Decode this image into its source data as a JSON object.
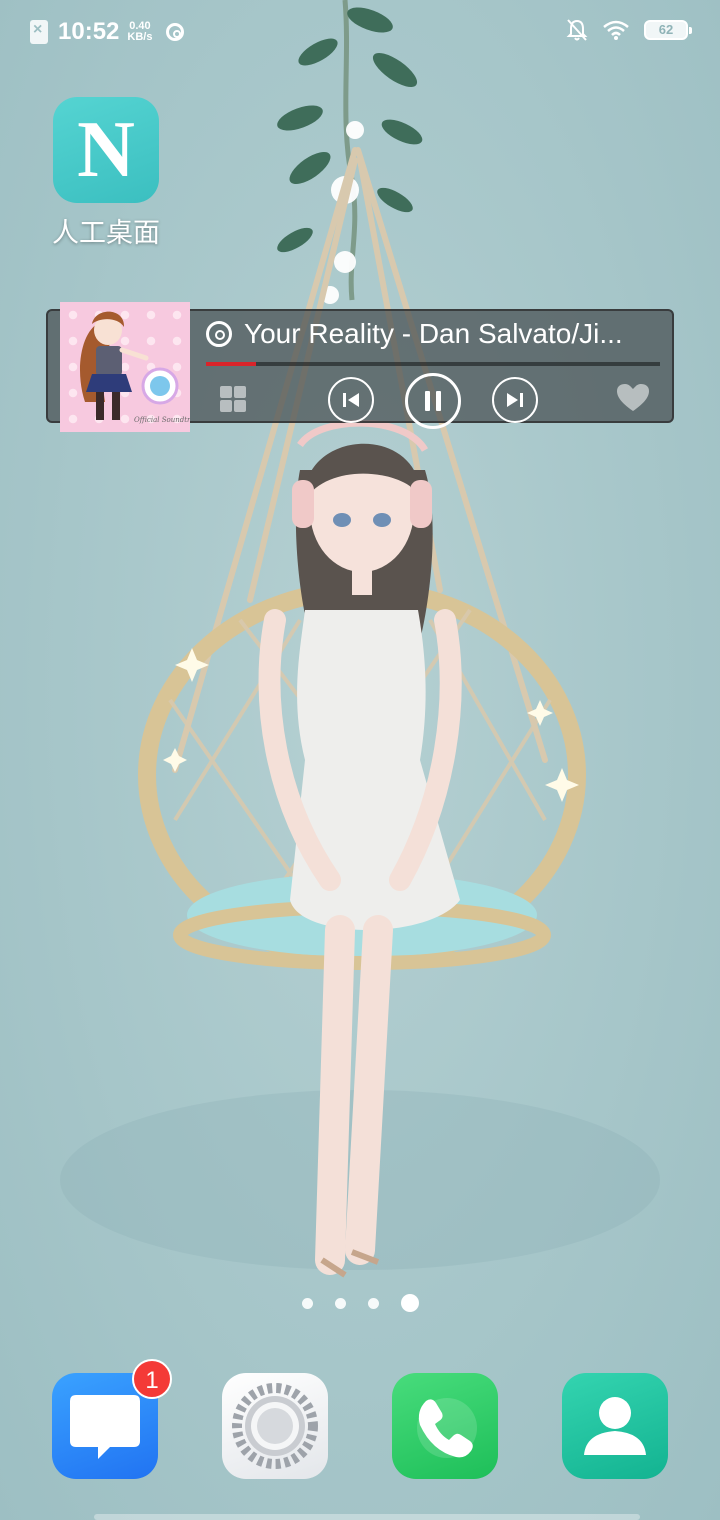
{
  "status_bar": {
    "time": "10:52",
    "net_speed_value": "0.40",
    "net_speed_unit": "KB/s",
    "battery": "62",
    "icons": [
      "sim-off-icon",
      "netease-music-icon",
      "bell-off-icon",
      "wifi-icon",
      "battery-icon"
    ]
  },
  "home_apps": [
    {
      "label": "人工桌面",
      "glyph": "N",
      "icon": "n-launcher-icon"
    }
  ],
  "music_widget": {
    "song_title": "Your Reality - Dan Salvato/Ji...",
    "progress_fraction": 0.11,
    "progress_color": "#d9242a",
    "album_caption": "Official Soundtrack",
    "controls": [
      "grid-icon",
      "previous-icon",
      "pause-icon",
      "next-icon",
      "heart-icon"
    ]
  },
  "page_indicator": {
    "count": 4,
    "active_index": 3
  },
  "dock": [
    {
      "name": "messages",
      "badge": "1",
      "icon": "chat-bubble-icon",
      "color": "#2a86f8"
    },
    {
      "name": "settings",
      "icon": "gear-icon",
      "color": "#f0f2f4"
    },
    {
      "name": "phone",
      "icon": "phone-icon",
      "color": "#2fcd66"
    },
    {
      "name": "contacts",
      "icon": "person-icon",
      "color": "#22c4a1"
    }
  ]
}
